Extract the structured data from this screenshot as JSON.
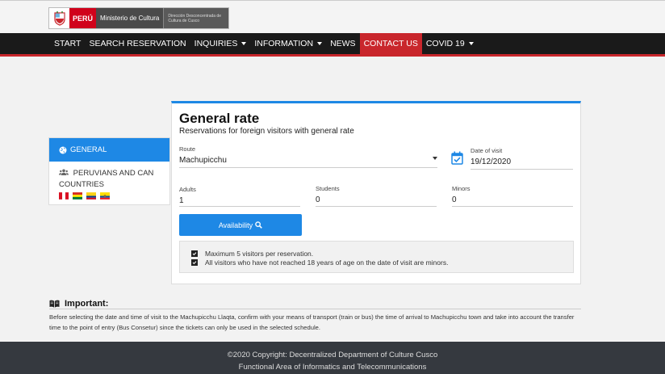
{
  "header": {
    "logo_peru": "PERÚ",
    "logo_ministry": "Ministerio de Cultura",
    "logo_direction": "Dirección Desconcentrada de Cultura de Cusco"
  },
  "nav": {
    "items": [
      {
        "label": "START"
      },
      {
        "label": "SEARCH RESERVATION"
      },
      {
        "label": "INQUIRIES"
      },
      {
        "label": "INFORMATION"
      },
      {
        "label": "NEWS"
      },
      {
        "label": "CONTACT US"
      },
      {
        "label": "COVID 19"
      }
    ]
  },
  "sidebar": {
    "general_label": "GENERAL",
    "peruvians_label": "PERUVIANS AND CAN COUNTRIES"
  },
  "form": {
    "title": "General rate",
    "subtitle": "Reservations for foreign visitors with general rate",
    "route_label": "Route",
    "route_value": "Machupicchu",
    "date_label": "Date of visit",
    "date_value": "19/12/2020",
    "adults_label": "Adults",
    "adults_value": "1",
    "students_label": "Students",
    "students_value": "0",
    "minors_label": "Minors",
    "minors_value": "0",
    "availability_label": "Availability",
    "note_1": "Maximum 5 visitors per reservation.",
    "note_2": "All visitors who have not reached 18 years of age on the date of visit are minors."
  },
  "important": {
    "heading": "Important:",
    "text": "Before selecting the date and time of visit to the Machupicchu Llaqta, confirm with your means of transport (train or bus) the time of arrival to Machupicchu town and take into account the transfer time to the point of entry (Bus Consetur) since the tickets can only be used in the selected schedule."
  },
  "footer": {
    "copyright": "2020 Copyright: Decentralized Department of Culture Cusco",
    "area": "Functional Area of Informatics and Telecommunications"
  },
  "colors": {
    "accent_blue": "#1e88e5",
    "nav_red": "#c9262c",
    "nav_dark": "#1a1a1a",
    "footer_dark": "#35393f"
  }
}
